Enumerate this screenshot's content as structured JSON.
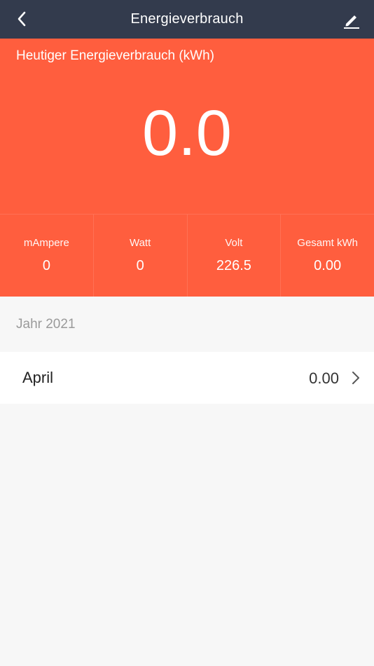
{
  "navbar": {
    "title": "Energieverbrauch",
    "back_icon": "chevron-left-icon",
    "edit_icon": "pencil-icon"
  },
  "hero": {
    "label": "Heutiger Energieverbrauch (kWh)",
    "value": "0.0",
    "color": "#ff5e3e"
  },
  "stats": [
    {
      "label": "mAmpere",
      "value": "0"
    },
    {
      "label": "Watt",
      "value": "0"
    },
    {
      "label": "Volt",
      "value": "226.5"
    },
    {
      "label": "Gesamt kWh",
      "value": "0.00"
    }
  ],
  "history": {
    "year_label": "Jahr 2021",
    "months": [
      {
        "name": "April",
        "value": "0.00"
      }
    ]
  }
}
